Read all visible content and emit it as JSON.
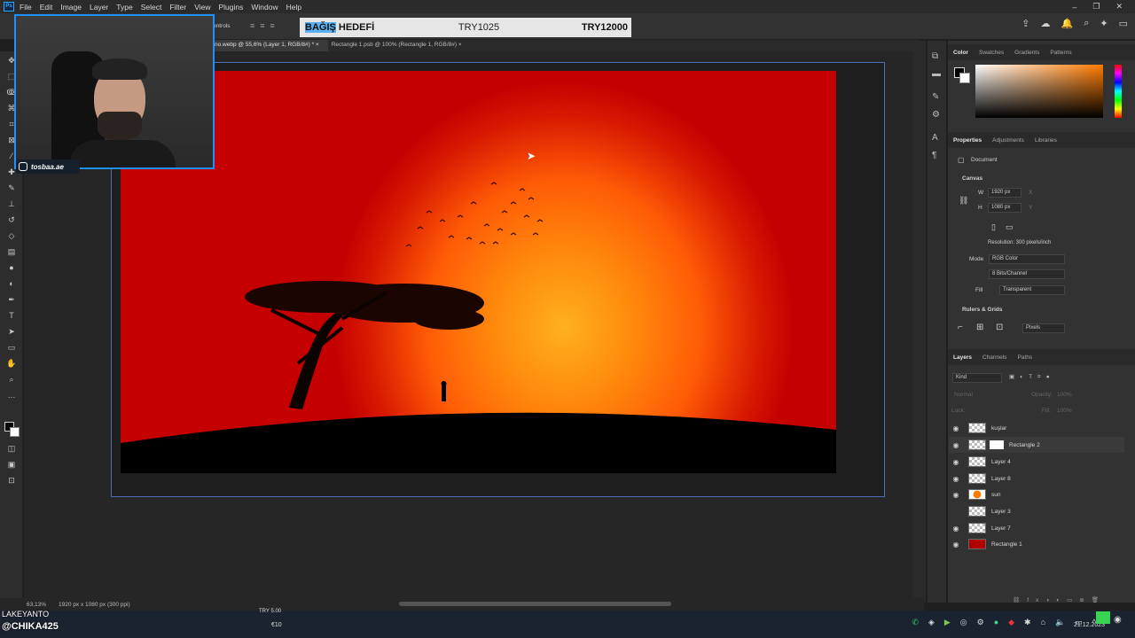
{
  "menu": {
    "app_logo": "Ps",
    "items": [
      "File",
      "Edit",
      "Image",
      "Layer",
      "Type",
      "Select",
      "Filter",
      "View",
      "Plugins",
      "Window",
      "Help"
    ]
  },
  "window_controls": [
    "–",
    "❐",
    "✕"
  ],
  "options_bar": {
    "controls_label": "ontrols"
  },
  "donation_banner": {
    "label_highlight": "BAĞIŞ",
    "label_rest": " HEDEFİ",
    "current": "TRY1025",
    "target": "TRY12000"
  },
  "tabs": [
    {
      "label": "no.webp @ 55,6% (Layer 1, RGB/8#) *",
      "close": "×"
    },
    {
      "label": "Rectangle 1.psb @ 100% (Rectangle 1, RGB/8#)",
      "close": "×"
    }
  ],
  "webcam": {
    "instagram_handle": "tosbaa.ae"
  },
  "color_panel": {
    "tabs": [
      "Color",
      "Swatches",
      "Gradients",
      "Patterns"
    ],
    "active_tab": "Color",
    "fg_color": "#000000",
    "bg_color": "#ffffff",
    "hue_color": "#ff7a00"
  },
  "properties_panel": {
    "tabs": [
      "Properties",
      "Adjustments",
      "Libraries"
    ],
    "section_label": "Document",
    "canvas_heading": "Canvas",
    "w_label": "W",
    "w_value": "1920 px",
    "h_label": "H",
    "h_value": "1080 px",
    "x_label": "X",
    "y_label": "Y",
    "resolution": "Resolution: 300 pixels/inch",
    "mode_label": "Mode",
    "mode_value": "RGB Color",
    "bits_value": "8 Bits/Channel",
    "fill_label": "Fill",
    "fill_value": "Transparent",
    "rulers_heading": "Rulers & Grids",
    "units_value": "Pixels"
  },
  "layers_panel": {
    "tabs": [
      "Layers",
      "Channels",
      "Paths"
    ],
    "filter_value": "Kind",
    "blend_mode": "Normal",
    "opacity_label": "Opacity:",
    "opacity_value": "100%",
    "lock_label": "Lock:",
    "fill_label": "Fill:",
    "fill_value": "100%",
    "layers": [
      {
        "name": "kuşlar",
        "visible": true
      },
      {
        "name": "Rectangle 2",
        "visible": true
      },
      {
        "name": "Layer 4",
        "visible": true
      },
      {
        "name": "Layer 8",
        "visible": true
      },
      {
        "name": "sun",
        "visible": true
      },
      {
        "name": "Layer 3",
        "visible": false
      },
      {
        "name": "Layer 7",
        "visible": true
      },
      {
        "name": "Rectangle 1",
        "visible": true
      }
    ]
  },
  "status_bar": {
    "zoom": "63,13%",
    "doc_info": "1920 px x 1080 px (300 ppi)"
  },
  "stream_overlay": {
    "name_top": "LAKEYANTO",
    "handle": "@CHIKA425",
    "ticker": "TRY 5.00",
    "euro": "€10"
  },
  "taskbar": {
    "time": "1",
    "date": "21.12.2023"
  }
}
